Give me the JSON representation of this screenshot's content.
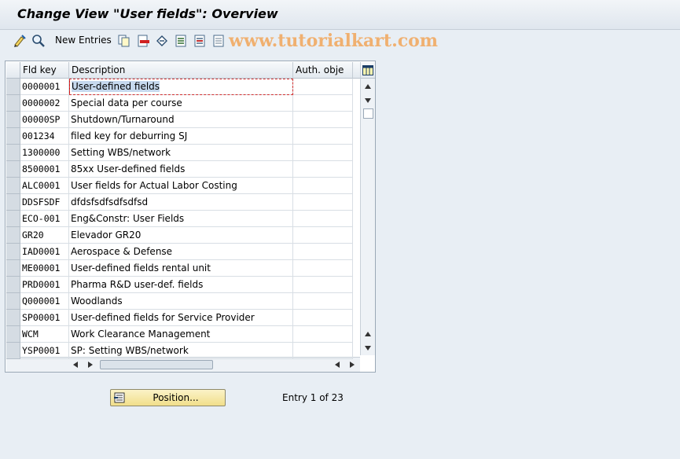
{
  "header": {
    "title": "Change View \"User fields\": Overview"
  },
  "toolbar": {
    "new_entries_label": "New Entries",
    "icons": [
      "edit-icon",
      "display-icon",
      "copy-icon",
      "delete-icon",
      "undo-icon",
      "select-all-icon",
      "select-block-icon",
      "deselect-all-icon"
    ]
  },
  "watermark": "www.tutorialkart.com",
  "table": {
    "columns": {
      "key": "Fld key",
      "desc": "Description",
      "auth": "Auth. obje"
    },
    "rows": [
      {
        "key": "0000001",
        "desc": "User-defined fields",
        "auth": ""
      },
      {
        "key": "0000002",
        "desc": "Special data per course",
        "auth": ""
      },
      {
        "key": "00000SP",
        "desc": "Shutdown/Turnaround",
        "auth": ""
      },
      {
        "key": "001234",
        "desc": "filed key for deburring SJ",
        "auth": ""
      },
      {
        "key": "1300000",
        "desc": "Setting WBS/network",
        "auth": ""
      },
      {
        "key": "8500001",
        "desc": "85xx User-defined fields",
        "auth": ""
      },
      {
        "key": "ALC0001",
        "desc": "User fields for Actual Labor Costing",
        "auth": ""
      },
      {
        "key": "DDSFSDF",
        "desc": "dfdsfsdfsdfsdfsd",
        "auth": ""
      },
      {
        "key": "ECO-001",
        "desc": "Eng&Constr: User Fields",
        "auth": ""
      },
      {
        "key": "GR20",
        "desc": "Elevador GR20",
        "auth": ""
      },
      {
        "key": "IAD0001",
        "desc": "Aerospace & Defense",
        "auth": ""
      },
      {
        "key": "ME00001",
        "desc": "User-defined fields rental unit",
        "auth": ""
      },
      {
        "key": "PRD0001",
        "desc": "Pharma R&D user-def. fields",
        "auth": ""
      },
      {
        "key": "Q000001",
        "desc": "Woodlands",
        "auth": ""
      },
      {
        "key": "SP00001",
        "desc": "User-defined fields for Service Provider",
        "auth": ""
      },
      {
        "key": "WCM",
        "desc": "Work Clearance Management",
        "auth": ""
      },
      {
        "key": "YSP0001",
        "desc": "SP: Setting WBS/network",
        "auth": ""
      }
    ]
  },
  "footer": {
    "position_label": "Position...",
    "entry_text": "Entry 1 of 23"
  },
  "colors": {
    "background": "#e8eef4",
    "selection": "#c6d9ee",
    "button": "#f1df8a"
  }
}
